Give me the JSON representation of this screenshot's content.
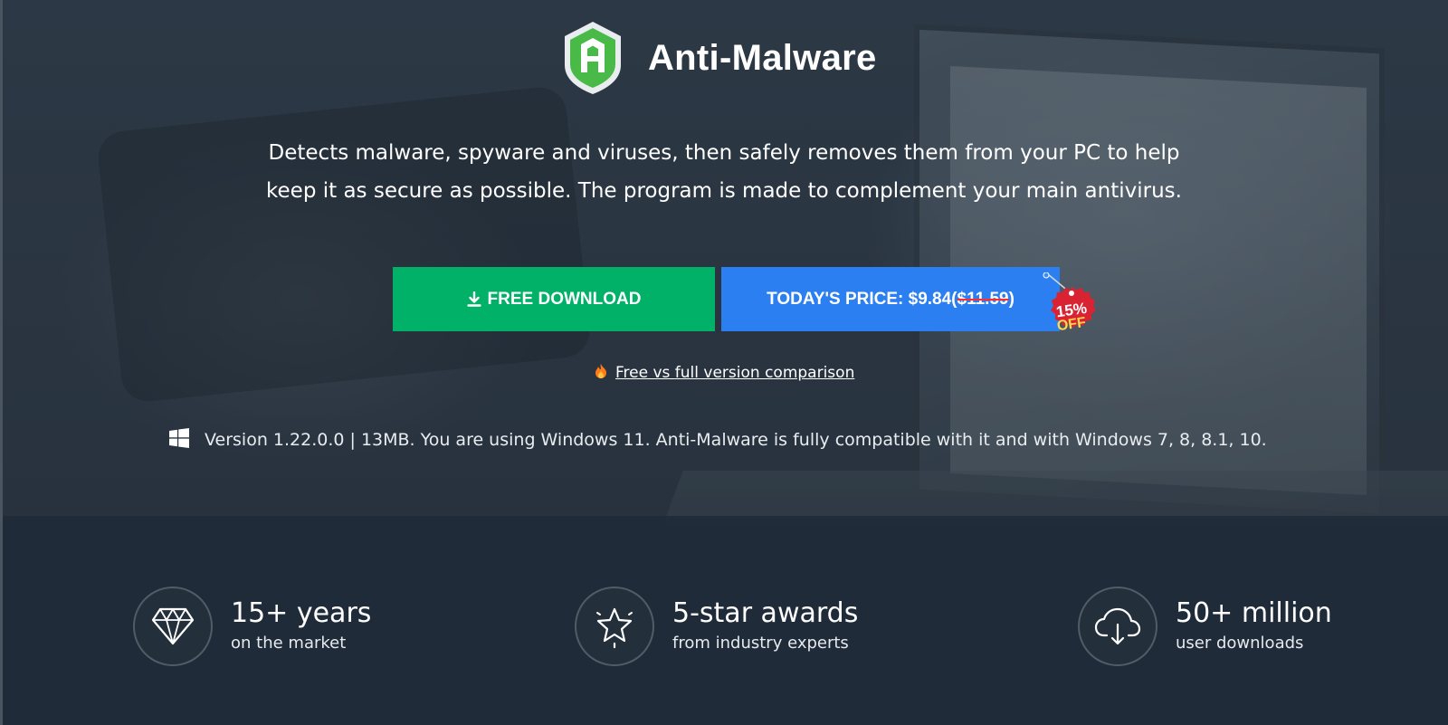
{
  "brand": {
    "name": "Anti-Malware"
  },
  "tagline": {
    "line1": "Detects malware, spyware and viruses, then safely removes them from your PC to help",
    "line2": "keep it as secure as possible. The program is made to complement your main antivirus."
  },
  "buttons": {
    "download_label": "FREE DOWNLOAD",
    "price_prefix": "TODAY'S PRICE: $9.84(",
    "price_old": "$11.59",
    "price_suffix": ")"
  },
  "discount_badge": {
    "percent": "15%",
    "off": "OFF"
  },
  "comparison_link": "Free vs full version comparison",
  "version_info": "Version 1.22.0.0 | 13MB. You are using Windows 11. Anti-Malware is fully compatible with it and with Windows 7, 8, 8.1, 10.",
  "stats": [
    {
      "icon": "diamond-icon",
      "title": "15+ years",
      "subtitle": "on the market"
    },
    {
      "icon": "star-icon",
      "title": "5-star awards",
      "subtitle": "from industry experts"
    },
    {
      "icon": "cloud-download-icon",
      "title": "50+ million",
      "subtitle": "user downloads"
    }
  ],
  "colors": {
    "download_button": "#00b167",
    "price_button": "#2b7ff0",
    "badge": "#d92332",
    "logo_green": "#49b948"
  }
}
